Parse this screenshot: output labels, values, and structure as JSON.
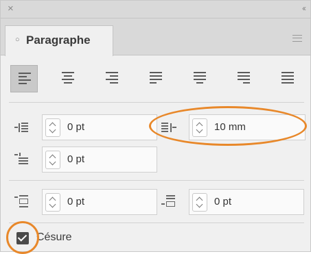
{
  "window": {
    "close_glyph": "×",
    "collapse_glyph": "‹‹"
  },
  "tab": {
    "title": "Paragraphe",
    "icon": "circle-arrows-icon"
  },
  "alignment": {
    "options": [
      "align-left-icon",
      "align-center-icon",
      "align-right-icon",
      "justify-left-icon",
      "justify-center-icon",
      "justify-right-icon",
      "justify-all-icon"
    ],
    "selected_index": 0
  },
  "indents": {
    "left_indent": {
      "value": "0 pt",
      "icon": "left-indent-icon"
    },
    "right_indent": {
      "value": "10 mm",
      "icon": "right-indent-icon"
    },
    "first_line_indent": {
      "value": "0 pt",
      "icon": "first-line-indent-icon"
    }
  },
  "spacing": {
    "space_before": {
      "value": "0 pt",
      "icon": "space-before-icon"
    },
    "space_after": {
      "value": "0 pt",
      "icon": "space-after-icon"
    }
  },
  "hyphenation": {
    "label": "Césure",
    "checked": true
  },
  "colors": {
    "highlight": "#e8882a",
    "panel_bg": "#f0f0f0",
    "titlebar_bg": "#d9d9d9"
  }
}
